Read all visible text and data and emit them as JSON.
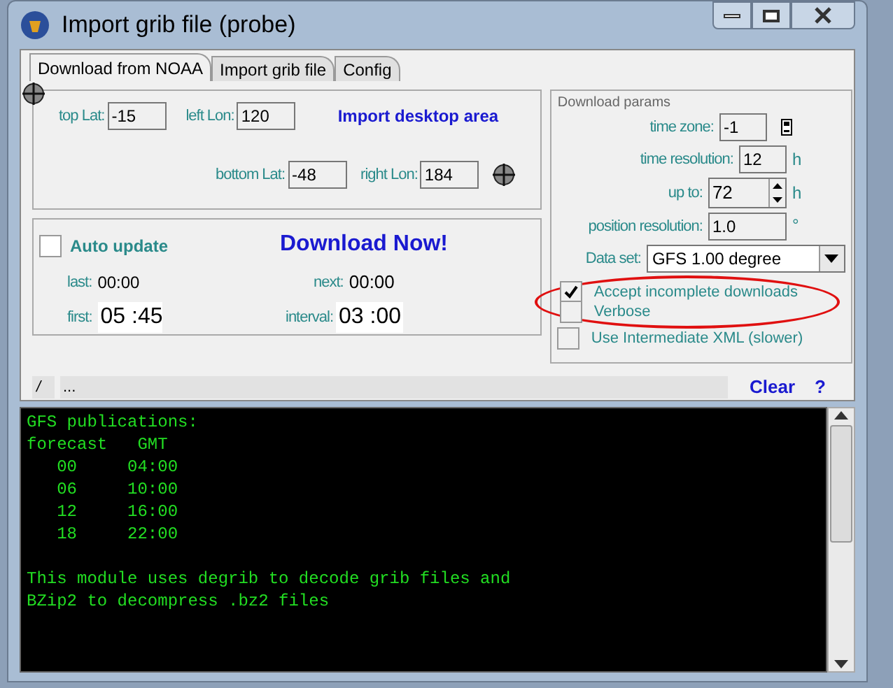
{
  "window": {
    "title": "Import grib file (probe)"
  },
  "tabs": [
    {
      "label": "Download from NOAA",
      "selected": true
    },
    {
      "label": "Import grib file",
      "selected": false
    },
    {
      "label": "Config",
      "selected": false
    }
  ],
  "area": {
    "fields": [
      {
        "label": "top Lat:",
        "value": "-15"
      },
      {
        "label": "left Lon:",
        "value": "120"
      },
      {
        "label": "bottom Lat:",
        "value": "-48"
      },
      {
        "label": "right Lon:",
        "value": "184"
      }
    ],
    "import_link": "Import desktop area"
  },
  "auto": {
    "checkbox": {
      "label": "Auto update",
      "checked": false
    },
    "download": "Download Now!",
    "last_label": "last:",
    "last": "00:00",
    "next_label": "next:",
    "next": "00:00",
    "first_label": "first:",
    "first": "05 :45",
    "interval_label": "interval:",
    "interval": "03 :00"
  },
  "params": {
    "title": "Download params",
    "time_zone": {
      "label": "time zone:",
      "value": "-1"
    },
    "time_resolution": {
      "label": "time resolution:",
      "value": "12",
      "unit": "h"
    },
    "up_to": {
      "label": "up to:",
      "value": "72",
      "unit": "h"
    },
    "position_resolution": {
      "label": "position resolution:",
      "value": "1.0",
      "unit": "°"
    },
    "data_set": {
      "label": "Data set:",
      "value": "GFS 1.00 degree"
    },
    "options": [
      {
        "label": "Accept incomplete downloads",
        "checked": true
      },
      {
        "label": "Verbose",
        "checked": false
      },
      {
        "label": "Use Intermediate XML (slower)",
        "checked": false
      }
    ]
  },
  "status": {
    "indicator": "/",
    "text": "...",
    "clear": "Clear",
    "help": "?"
  },
  "console": {
    "paragraphs": [
      [
        "GFS publications:",
        "forecast   GMT",
        "   00     04:00",
        "   06     10:00",
        "   12     16:00",
        "   18     22:00"
      ],
      [
        "This module uses degrib to decode grib files and",
        "BZip2 to decompress .bz2 files"
      ]
    ]
  }
}
